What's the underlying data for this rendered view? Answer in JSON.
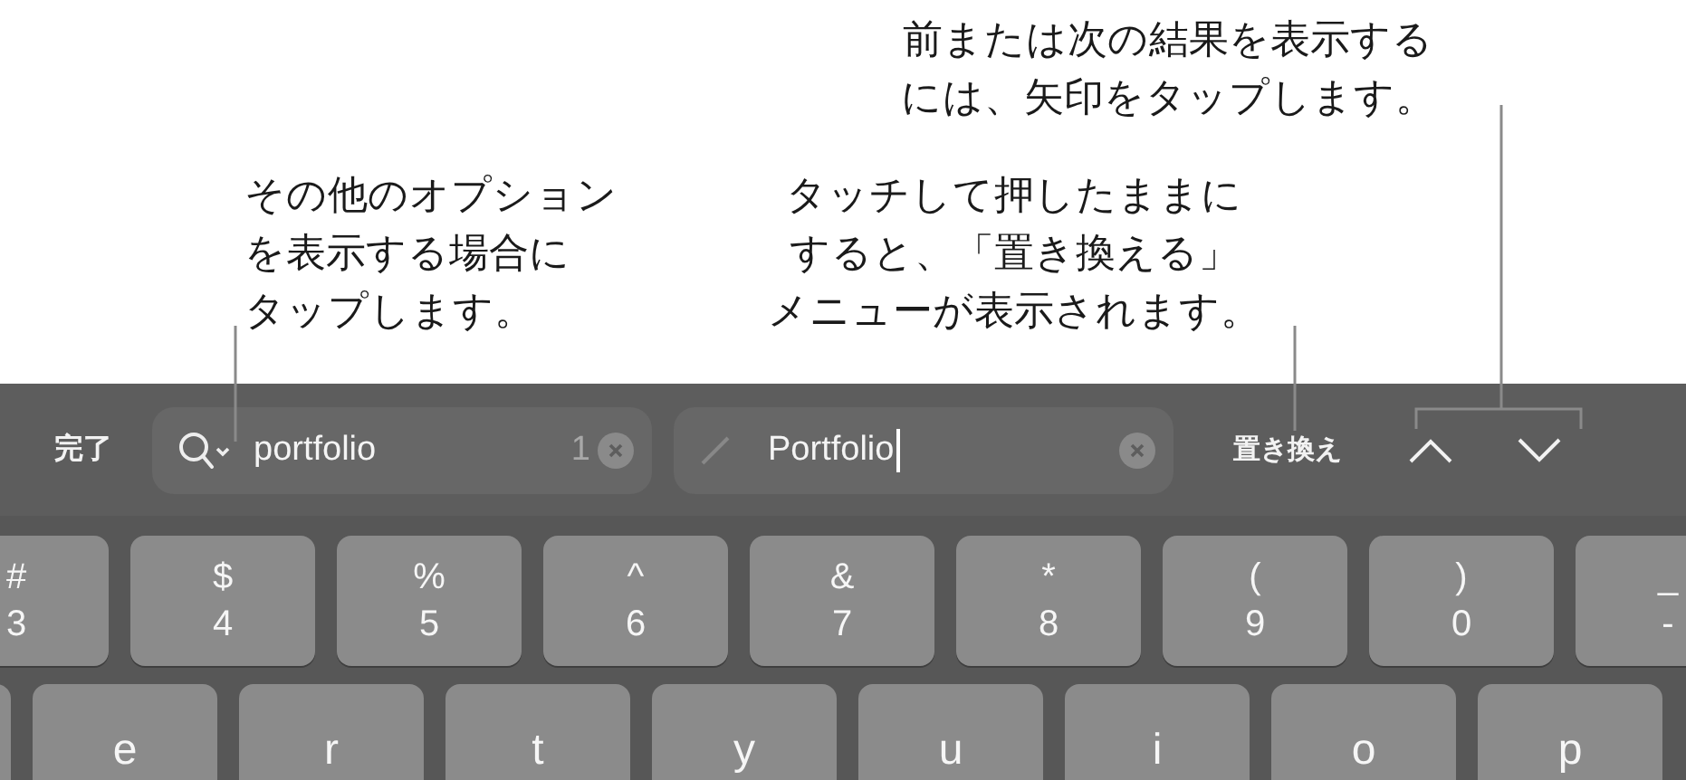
{
  "callouts": [
    {
      "lines": [
        "その他のオプション",
        "を表示する場合に",
        "タップします。"
      ]
    },
    {
      "lines": [
        "タッチして押したままに",
        "すると、「置き換える」",
        "メニューが表示されます。"
      ]
    },
    {
      "lines": [
        "前または次の結果を表示する",
        "には、矢印をタップします。"
      ]
    }
  ],
  "find_bar": {
    "done": "完了",
    "search": {
      "value": "portfolio",
      "match_count": "1"
    },
    "replace": {
      "value": "Portfolio"
    },
    "replace_button": "置き換え"
  },
  "keys": {
    "row_1": [
      {
        "shift": "#",
        "main": "3"
      },
      {
        "shift": "$",
        "main": "4"
      },
      {
        "shift": "%",
        "main": "5"
      },
      {
        "shift": "^",
        "main": "6"
      },
      {
        "shift": "&",
        "main": "7"
      },
      {
        "shift": "*",
        "main": "8"
      },
      {
        "shift": "(",
        "main": "9"
      },
      {
        "shift": ")",
        "main": "0"
      },
      {
        "shift": "_",
        "main": "-"
      }
    ],
    "row_2": [
      "e",
      "r",
      "t",
      "y",
      "u",
      "i",
      "o",
      "p"
    ]
  }
}
